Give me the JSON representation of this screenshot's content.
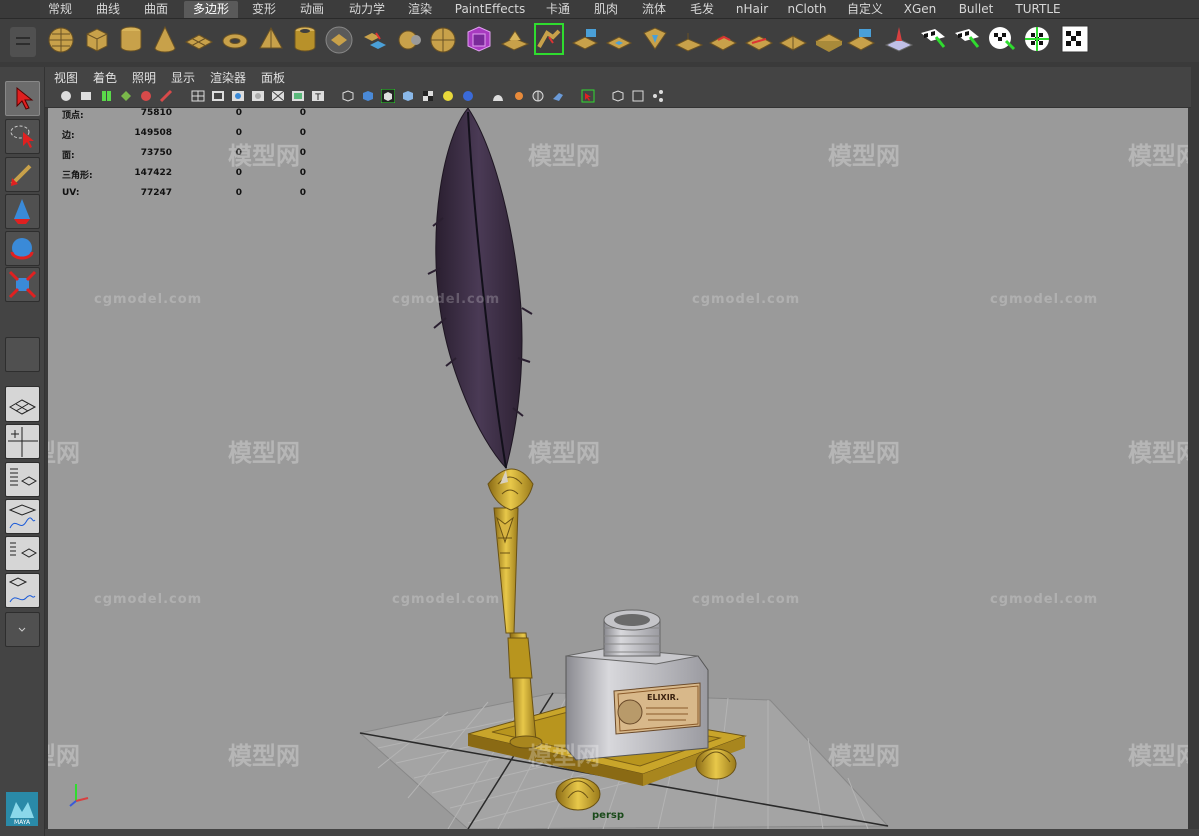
{
  "menu_tabs": [
    "常规",
    "曲线",
    "曲面",
    "多边形",
    "变形",
    "动画",
    "动力学",
    "渲染",
    "PaintEffects",
    "卡通",
    "肌肉",
    "流体",
    "毛发",
    "nHair",
    "nCloth",
    "自定义",
    "XGen",
    "Bullet",
    "TURTLE"
  ],
  "active_tab": "多边形",
  "viewport_menu": [
    "视图",
    "着色",
    "照明",
    "显示",
    "渲染器",
    "面板"
  ],
  "hud": {
    "rows": [
      {
        "label": "顶点:",
        "v1": "75810",
        "v2": "0",
        "v3": "0"
      },
      {
        "label": "边:",
        "v1": "149508",
        "v2": "0",
        "v3": "0"
      },
      {
        "label": "面:",
        "v1": "73750",
        "v2": "0",
        "v3": "0"
      },
      {
        "label": "三角形:",
        "v1": "147422",
        "v2": "0",
        "v3": "0"
      },
      {
        "label": "UV:",
        "v1": "77247",
        "v2": "0",
        "v3": "0"
      }
    ]
  },
  "camera_label": "persp",
  "label_text": {
    "brand": "ELIXIR."
  },
  "maya_logo_text": "MAYA",
  "watermarks": {
    "cg": "cgmodel.com",
    "big": "模型网"
  },
  "colors": {
    "viewport_bg": "#9a9a9a",
    "ui_bg": "#444444",
    "gold": "#c9a52a",
    "feather": "#3a2c3e"
  }
}
